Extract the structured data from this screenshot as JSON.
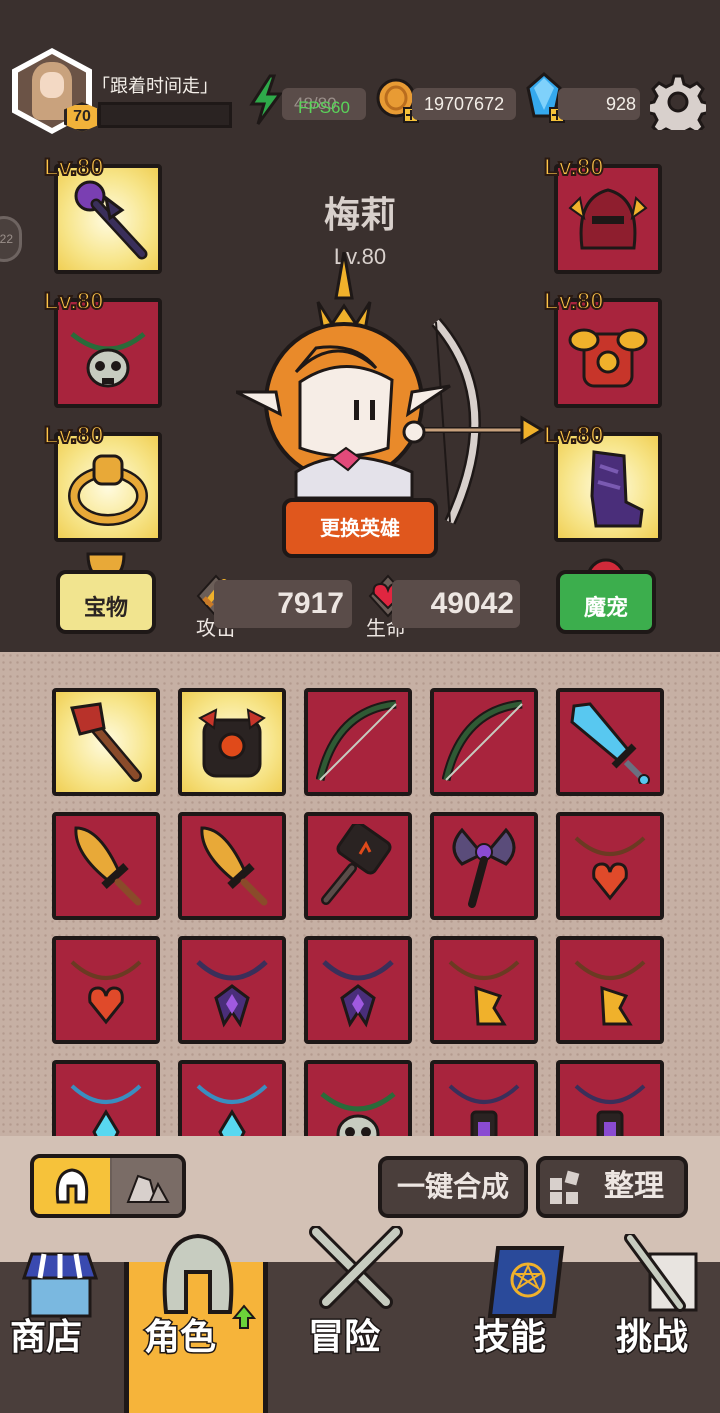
{
  "player": {
    "name": "「跟着时间走」",
    "level": "70"
  },
  "resources": {
    "energy": "48/80",
    "fps": "FPS60",
    "coins": "19707672",
    "gems": "928"
  },
  "side_badge": "22",
  "hero": {
    "name": "梅莉",
    "level": "Lv.80",
    "swap_label": "更换英雄"
  },
  "equipment": {
    "left": [
      {
        "lv": "Lv.80",
        "icon": "shadow-staff-icon"
      },
      {
        "lv": "Lv.80",
        "icon": "skull-necklace-icon"
      },
      {
        "lv": "Lv.80",
        "icon": "fist-ring-icon"
      }
    ],
    "right": [
      {
        "lv": "Lv.80",
        "icon": "flame-helmet-icon"
      },
      {
        "lv": "Lv.80",
        "icon": "gold-armor-icon"
      },
      {
        "lv": "Lv.80",
        "icon": "shadow-boots-icon"
      }
    ]
  },
  "treasure_label": "宝物",
  "pet_label": "魔宠",
  "stats": {
    "attack_label": "攻击",
    "attack": "7917",
    "hp_label": "生命",
    "hp": "49042"
  },
  "inventory": [
    [
      "meat-club-icon",
      "lava-armor-icon",
      "vine-bow-icon",
      "vine-bow-icon",
      "ice-sword-icon"
    ],
    [
      "golden-sword-icon",
      "golden-sword-icon",
      "fire-hammer-icon",
      "shadow-axe-icon",
      "heart-necklace-icon"
    ],
    [
      "heart-necklace-icon",
      "shadow-necklace-icon",
      "shadow-necklace-icon",
      "axe-necklace-icon",
      "axe-necklace-icon"
    ],
    [
      "crystal-necklace-icon",
      "crystal-necklace-icon",
      "skull-necklace-icon",
      "lantern-necklace-icon",
      "lantern-necklace-icon"
    ]
  ],
  "actions": {
    "merge_label": "一键合成",
    "sort_label": "整理"
  },
  "nav": {
    "shop": "商店",
    "hero": "角色",
    "adventure": "冒险",
    "skills": "技能",
    "challenge": "挑战"
  },
  "colors": {
    "gold_slot": "#f7e58a",
    "red_slot": "#a8243d",
    "accent_orange": "#e0571d",
    "nav_active": "#f6b43a"
  }
}
